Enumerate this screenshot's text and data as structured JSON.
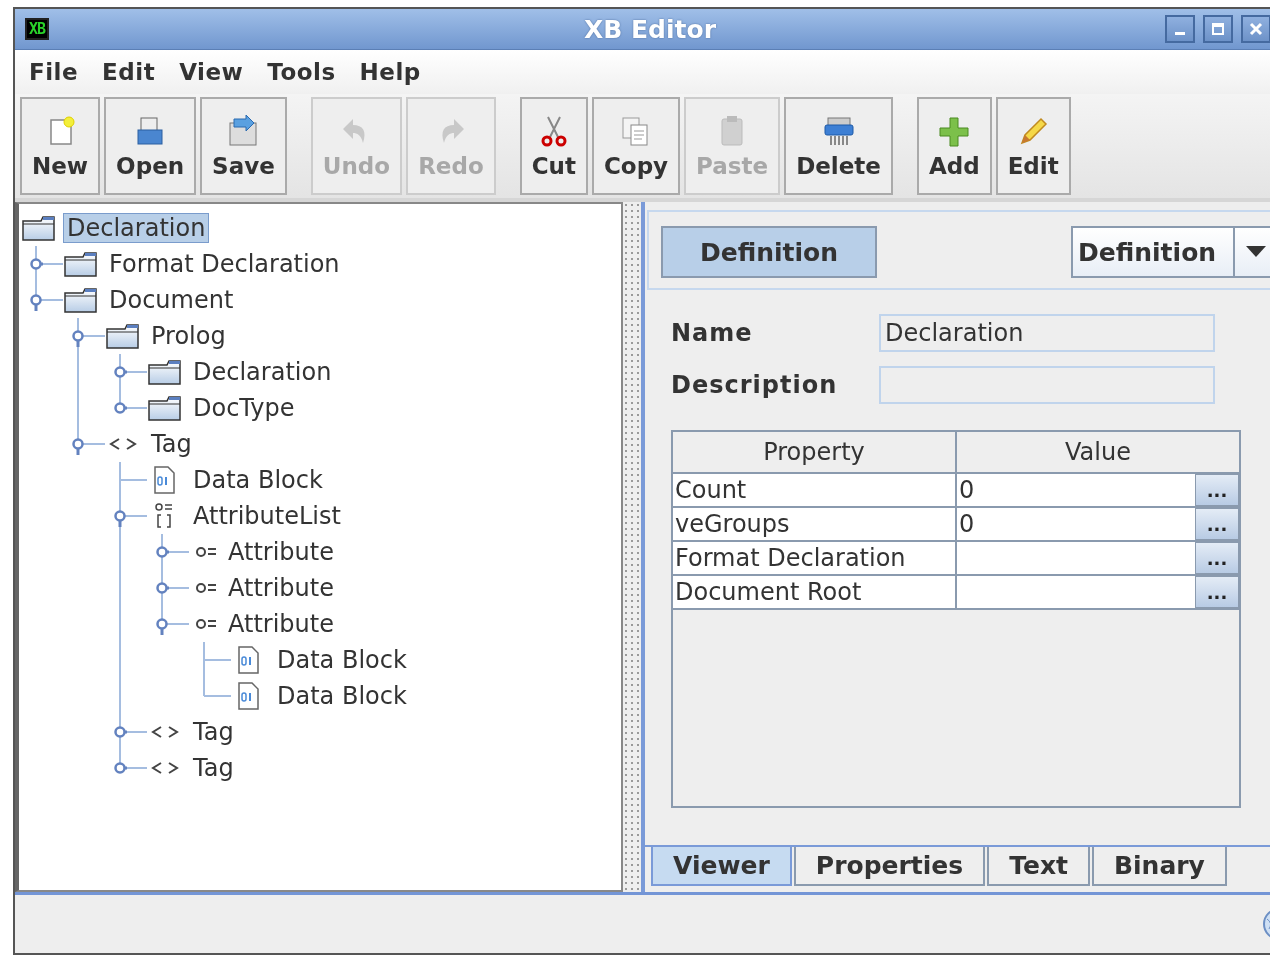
{
  "window": {
    "title": "XB Editor",
    "app_icon": "XB"
  },
  "menu": [
    "File",
    "Edit",
    "View",
    "Tools",
    "Help"
  ],
  "toolbar": [
    [
      {
        "label": "New",
        "kind": "new",
        "disabled": false
      },
      {
        "label": "Open",
        "kind": "open",
        "disabled": false
      },
      {
        "label": "Save",
        "kind": "save",
        "disabled": false
      }
    ],
    [
      {
        "label": "Undo",
        "kind": "undo",
        "disabled": true
      },
      {
        "label": "Redo",
        "kind": "redo",
        "disabled": true
      }
    ],
    [
      {
        "label": "Cut",
        "kind": "cut",
        "disabled": false
      },
      {
        "label": "Copy",
        "kind": "copy",
        "disabled": false
      },
      {
        "label": "Paste",
        "kind": "paste",
        "disabled": true
      },
      {
        "label": "Delete",
        "kind": "delete",
        "disabled": false
      }
    ],
    [
      {
        "label": "Add",
        "kind": "add",
        "disabled": false
      },
      {
        "label": "Edit",
        "kind": "edit",
        "disabled": false
      }
    ]
  ],
  "tree": [
    {
      "label": "Declaration",
      "kind": "folder",
      "selected": true,
      "children": [
        {
          "label": "Format Declaration",
          "kind": "folder",
          "selected": false,
          "expanded": false
        },
        {
          "label": "Document",
          "kind": "folder",
          "selected": false,
          "expanded": true,
          "children": [
            {
              "label": "Prolog",
              "kind": "folder",
              "selected": false,
              "expanded": true,
              "children": [
                {
                  "label": "Declaration",
                  "kind": "folder",
                  "selected": false,
                  "expanded": false
                },
                {
                  "label": "DocType",
                  "kind": "folder",
                  "selected": false,
                  "expanded": false
                }
              ]
            },
            {
              "label": "Tag",
              "kind": "tag",
              "selected": false,
              "expanded": true,
              "children": [
                {
                  "label": "Data Block",
                  "kind": "data",
                  "selected": false
                },
                {
                  "label": "AttributeList",
                  "kind": "attrlist",
                  "selected": false,
                  "expanded": true,
                  "children": [
                    {
                      "label": "Attribute",
                      "kind": "attribute",
                      "selected": false,
                      "expanded": false
                    },
                    {
                      "label": "Attribute",
                      "kind": "attribute",
                      "selected": false,
                      "expanded": false
                    },
                    {
                      "label": "Attribute",
                      "kind": "attribute",
                      "selected": false,
                      "expanded": true,
                      "children": [
                        {
                          "label": "Data Block",
                          "kind": "data",
                          "selected": false
                        },
                        {
                          "label": "Data Block",
                          "kind": "data",
                          "selected": false
                        }
                      ]
                    }
                  ]
                },
                {
                  "label": "Tag",
                  "kind": "tag",
                  "selected": false,
                  "expanded": false
                },
                {
                  "label": "Tag",
                  "kind": "tag",
                  "selected": false,
                  "expanded": false
                }
              ]
            }
          ]
        }
      ]
    }
  ],
  "editor": {
    "mode_button": {
      "label": "Definition",
      "selected": true
    },
    "mode_select": {
      "value": "Definition"
    },
    "fields": [
      {
        "label": "Name",
        "value": "Declaration"
      },
      {
        "label": "Description"
      }
    ],
    "table": {
      "columns": [
        "Property",
        "Value"
      ],
      "rows": [
        {
          "property": "Count",
          "value": "0",
          "action": "..."
        },
        {
          "property": "veGroups",
          "value": "0",
          "action": "..."
        },
        {
          "property": "Format Declaration",
          "value": "",
          "action": "..."
        },
        {
          "property": "Document Root",
          "value": "",
          "action": "..."
        }
      ]
    },
    "tabs": [
      {
        "label": "Viewer",
        "selected": true
      },
      {
        "label": "Properties",
        "selected": false
      },
      {
        "label": "Text",
        "selected": false
      },
      {
        "label": "Binary",
        "selected": false
      }
    ]
  }
}
